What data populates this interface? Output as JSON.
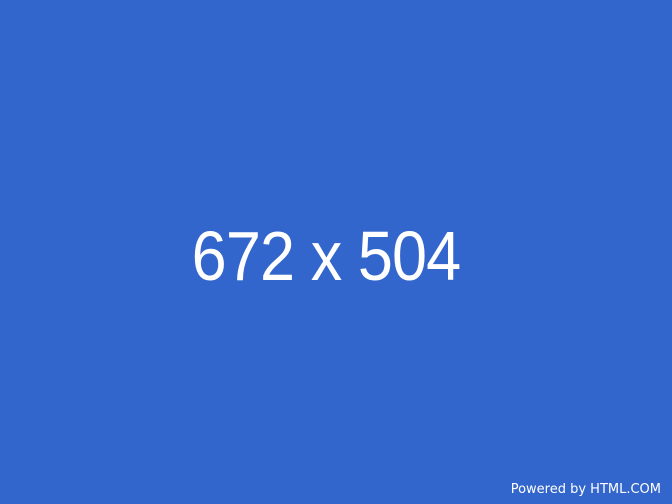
{
  "placeholder": {
    "dimensions_label": "672 x 504",
    "background_color": "#3366cc",
    "text_color": "#ffffff",
    "credit": "Powered by HTML.COM"
  }
}
